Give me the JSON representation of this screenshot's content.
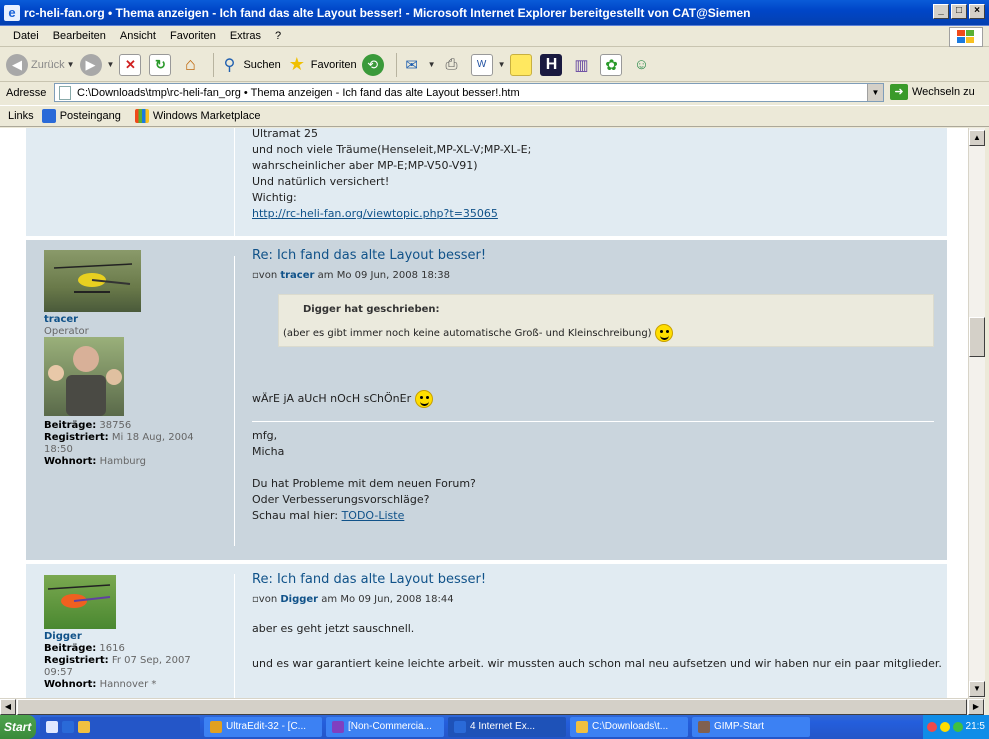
{
  "window": {
    "title": "rc-heli-fan.org • Thema anzeigen - Ich fand das alte Layout besser! - Microsoft Internet Explorer bereitgestellt von CAT@Siemen"
  },
  "menu": [
    "Datei",
    "Bearbeiten",
    "Ansicht",
    "Favoriten",
    "Extras",
    "?"
  ],
  "toolbar": {
    "back": "Zurück",
    "search": "Suchen",
    "favorites": "Favoriten"
  },
  "address": {
    "label": "Adresse",
    "value": "C:\\Downloads\\tmp\\rc-heli-fan_org • Thema anzeigen - Ich fand das alte Layout besser!.htm",
    "go": "Wechseln zu"
  },
  "links": {
    "label": "Links",
    "items": [
      "Posteingang",
      "Windows Marketplace"
    ]
  },
  "post0": {
    "lines": [
      "Ultramat 25",
      "und noch viele Träume(Henseleit,MP-XL-V;MP-XL-E;",
      "wahrscheinlicher aber MP-E;MP-V50-V91)",
      "Und natürlich versichert!",
      "Wichtig:"
    ],
    "link": "http://rc-heli-fan.org/viewtopic.php?t=35065"
  },
  "post1": {
    "username": "tracer",
    "rank": "Operator",
    "posts_label": "Beiträge:",
    "posts": "38756",
    "reg_label": "Registriert:",
    "registered": "Mi 18 Aug, 2004 18:50",
    "loc_label": "Wohnort:",
    "location": "Hamburg",
    "title": "Re: Ich fand das alte Layout besser!",
    "meta_pre": "von",
    "author": "tracer",
    "meta_post": "am Mo 09 Jun, 2008 18:38",
    "quote_author": "Digger hat geschrieben:",
    "quote_text": "(aber es gibt immer noch keine automatische Groß- und Kleinschreibung)",
    "body": "wÄrE jA aUcH nOcH sChÖnEr",
    "sig1": "mfg,",
    "sig2": "Micha",
    "sig3": "Du hat Probleme mit dem neuen Forum?",
    "sig4": "Oder Verbesserungsvorschläge?",
    "sig5": "Schau mal hier:",
    "sig_link": "TODO-Liste"
  },
  "post2": {
    "username": "Digger",
    "posts_label": "Beiträge:",
    "posts": "1616",
    "reg_label": "Registriert:",
    "registered": "Fr 07 Sep, 2007 09:57",
    "loc_label": "Wohnort:",
    "location": "Hannover *",
    "title": "Re: Ich fand das alte Layout besser!",
    "meta_pre": "von",
    "author": "Digger",
    "meta_post": "am Mo 09 Jun, 2008 18:44",
    "body1": "aber es geht jetzt sauschnell.",
    "body2": "und es war garantiert keine leichte arbeit. wir mussten auch schon mal neu aufsetzen und wir haben nur ein paar mitglieder."
  },
  "taskbar": {
    "start": "Start",
    "items": [
      "UltraEdit-32 - [C...",
      "[Non-Commercia...",
      "4 Internet Ex...",
      "C:\\Downloads\\t...",
      "GIMP-Start"
    ],
    "clock": "21:5"
  }
}
